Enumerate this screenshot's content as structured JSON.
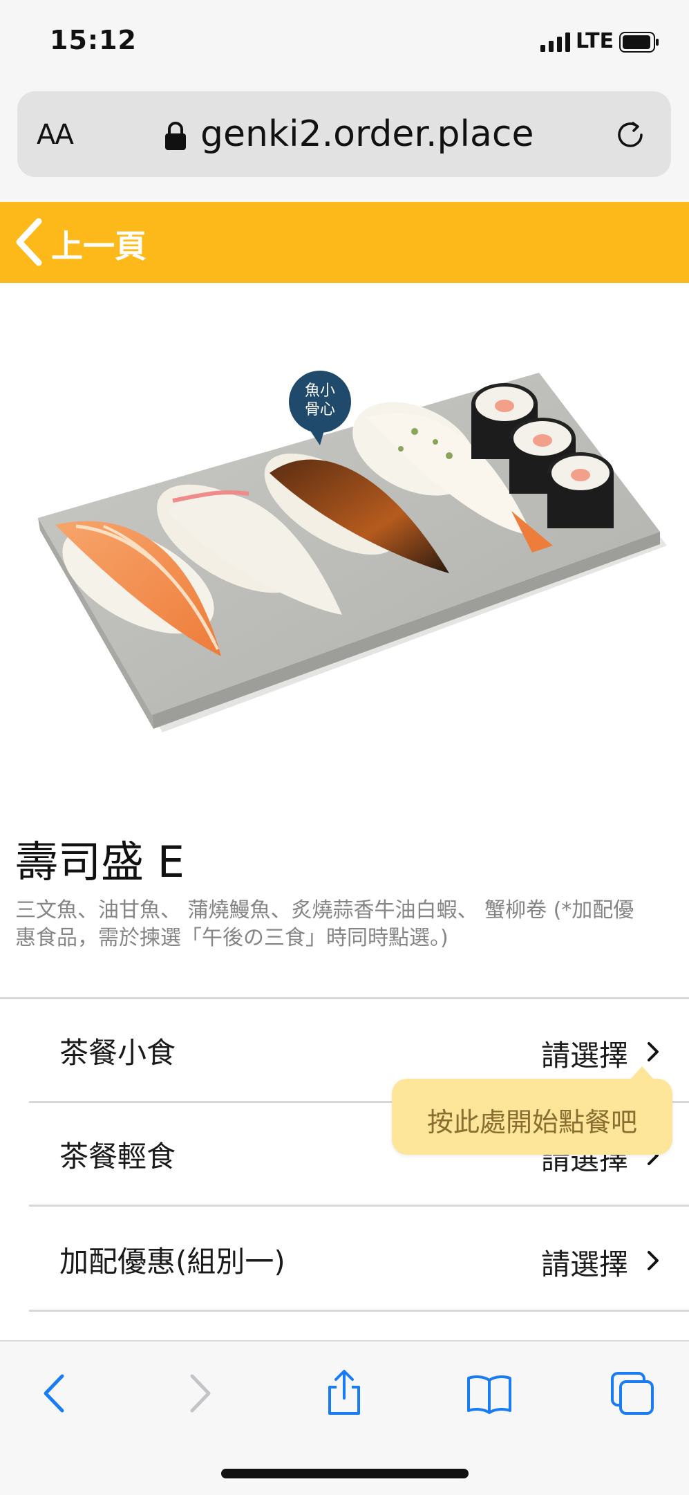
{
  "status_bar": {
    "time": "15:12",
    "network": "LTE"
  },
  "browser": {
    "text_size_label": "AA",
    "url": "genki2.order.place"
  },
  "header": {
    "back_label": "上一頁",
    "accent_color": "#fdb919"
  },
  "product": {
    "badge_text": "魚骨小心",
    "title": "壽司盛 E",
    "description": "三文魚、油甘魚、 蒲燒鰻魚、炙燒蒜香牛油白蝦、 蟹柳卷 (*加配優惠食品，需於揀選「午後の三食」時同時點選。)"
  },
  "options": [
    {
      "label": "茶餐小食",
      "value": "請選擇"
    },
    {
      "label": "茶餐輕食",
      "value": "請選擇"
    },
    {
      "label": "加配優惠(組別一)",
      "value": "請選擇"
    }
  ],
  "tooltip": {
    "text": "按此處開始點餐吧"
  },
  "toolbar": {
    "icons": [
      "back-icon",
      "forward-icon",
      "share-icon",
      "bookmarks-icon",
      "tabs-icon"
    ],
    "accent_color": "#1a7cf5"
  }
}
